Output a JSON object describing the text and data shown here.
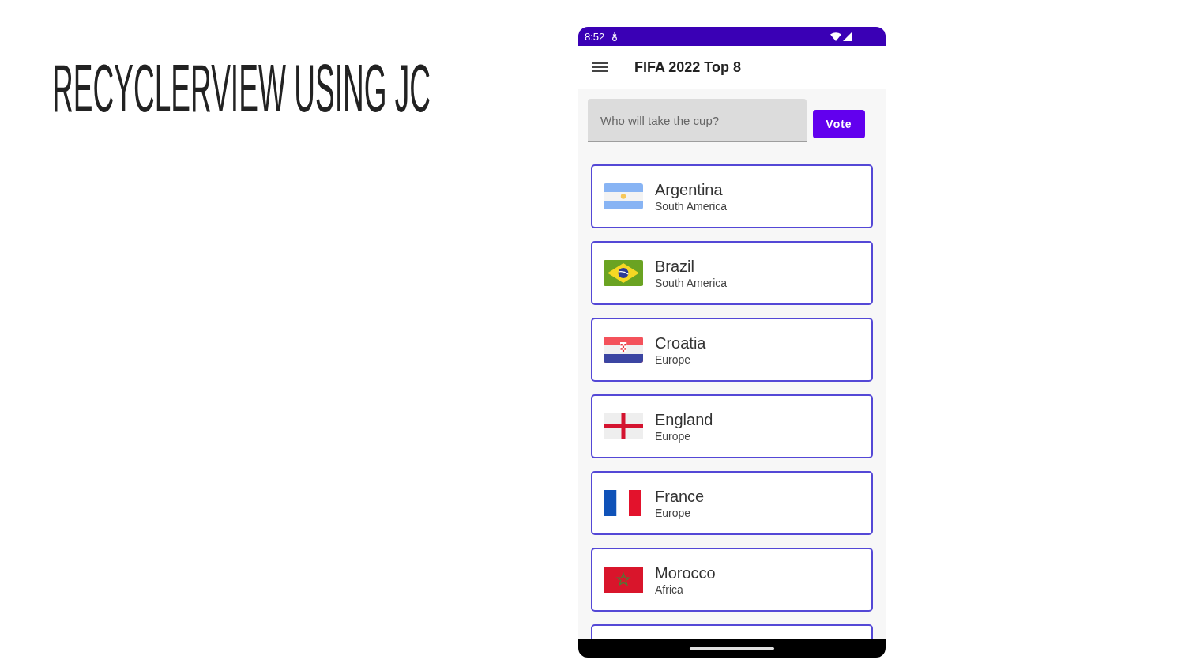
{
  "slide_title": "RECYCLERVIEW USING JC",
  "status_bar": {
    "time": "8:52"
  },
  "app_bar": {
    "title": "FIFA 2022 Top 8"
  },
  "vote_form": {
    "placeholder": "Who will take the cup?",
    "button": "Vote"
  },
  "countries": [
    {
      "name": "Argentina",
      "region": "South America"
    },
    {
      "name": "Brazil",
      "region": "South America"
    },
    {
      "name": "Croatia",
      "region": "Europe"
    },
    {
      "name": "England",
      "region": "Europe"
    },
    {
      "name": "France",
      "region": "Europe"
    },
    {
      "name": "Morocco",
      "region": "Africa"
    }
  ],
  "list": {
    "more_below": true
  }
}
